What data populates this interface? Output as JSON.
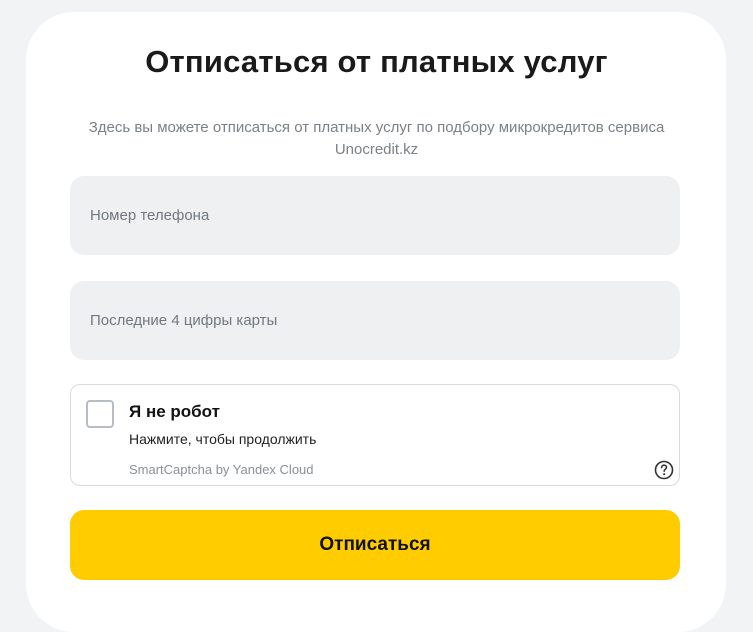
{
  "header": {
    "title": "Отписаться от платных услуг",
    "subtitle": "Здесь вы можете отписаться от платных услуг по подбору микрокредитов сервиса Unocredit.kz"
  },
  "form": {
    "phone_placeholder": "Номер телефона",
    "card_placeholder": "Последние 4 цифры карты",
    "submit_label": "Отписаться"
  },
  "captcha": {
    "title": "Я не робот",
    "hint": "Нажмите, чтобы продолжить",
    "brand": "SmartCaptcha by Yandex Cloud",
    "checked": false,
    "help_icon": "question-circle-icon"
  },
  "colors": {
    "accent": "#ffcc00",
    "input_bg": "#eef0f2",
    "page_bg": "#f2f3f5"
  }
}
